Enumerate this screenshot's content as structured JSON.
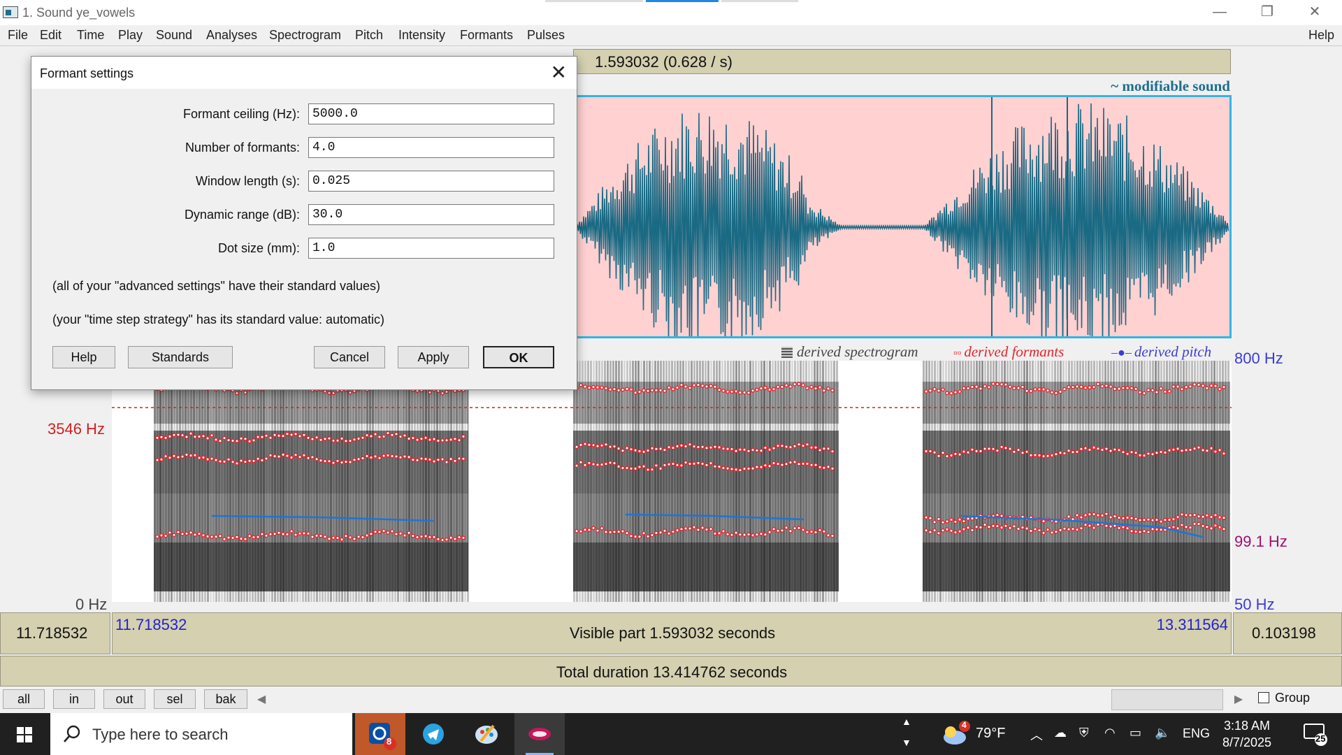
{
  "window": {
    "title": "1. Sound ye_vowels",
    "minimize_glyph": "—",
    "restore_glyph": "❐",
    "close_glyph": "✕"
  },
  "menu": [
    "File",
    "Edit",
    "Time",
    "Play",
    "Sound",
    "Analyses",
    "Spectrogram",
    "Pitch",
    "Intensity",
    "Formants",
    "Pulses"
  ],
  "help_menu": "Help",
  "editor": {
    "top_readout": "1.593032 (0.628 / s)",
    "modifiable_label": "~ modifiable sound",
    "legend": {
      "spectrogram": "derived spectrogram",
      "formants": "derived formants",
      "pitch": "derived pitch",
      "spectrogram_color": "#444444",
      "formants_color": "#e8222a",
      "pitch_color": "#3b3bd6"
    },
    "left_axis": {
      "top": "3546 Hz",
      "bottom": "0 Hz"
    },
    "right_axis": {
      "top": "800 Hz",
      "mid": "99.1 Hz",
      "bottom": "50 Hz"
    },
    "time": {
      "left_cursor": "11.718532",
      "visible_start": "11.718532",
      "visible_part": "Visible part 1.593032 seconds",
      "visible_end": "13.311564",
      "right_value": "0.103198",
      "total": "Total duration 13.414762 seconds"
    }
  },
  "zoom_buttons": [
    "all",
    "in",
    "out",
    "sel",
    "bak"
  ],
  "group_label": "Group",
  "dialog": {
    "title": "Formant settings",
    "close_glyph": "✕",
    "fields": [
      {
        "label": "Formant ceiling (Hz):",
        "value": "5000.0"
      },
      {
        "label": "Number of formants:",
        "value": "4.0"
      },
      {
        "label": "Window length (s):",
        "value": "0.025"
      },
      {
        "label": "Dynamic range (dB):",
        "value": "30.0"
      },
      {
        "label": "Dot size (mm):",
        "value": "1.0"
      }
    ],
    "note1": "(all of your \"advanced settings\" have their standard values)",
    "note2": "(your \"time step strategy\" has its standard value: automatic)",
    "buttons": {
      "help": "Help",
      "standards": "Standards",
      "cancel": "Cancel",
      "apply": "Apply",
      "ok": "OK"
    }
  },
  "taskbar": {
    "search_placeholder": "Type here to search",
    "badge_count": "8",
    "weather": "79°F",
    "weather_badge": "4",
    "language": "ENG",
    "time": "3:18 AM",
    "date": "8/7/2025",
    "notification_count": "25"
  }
}
